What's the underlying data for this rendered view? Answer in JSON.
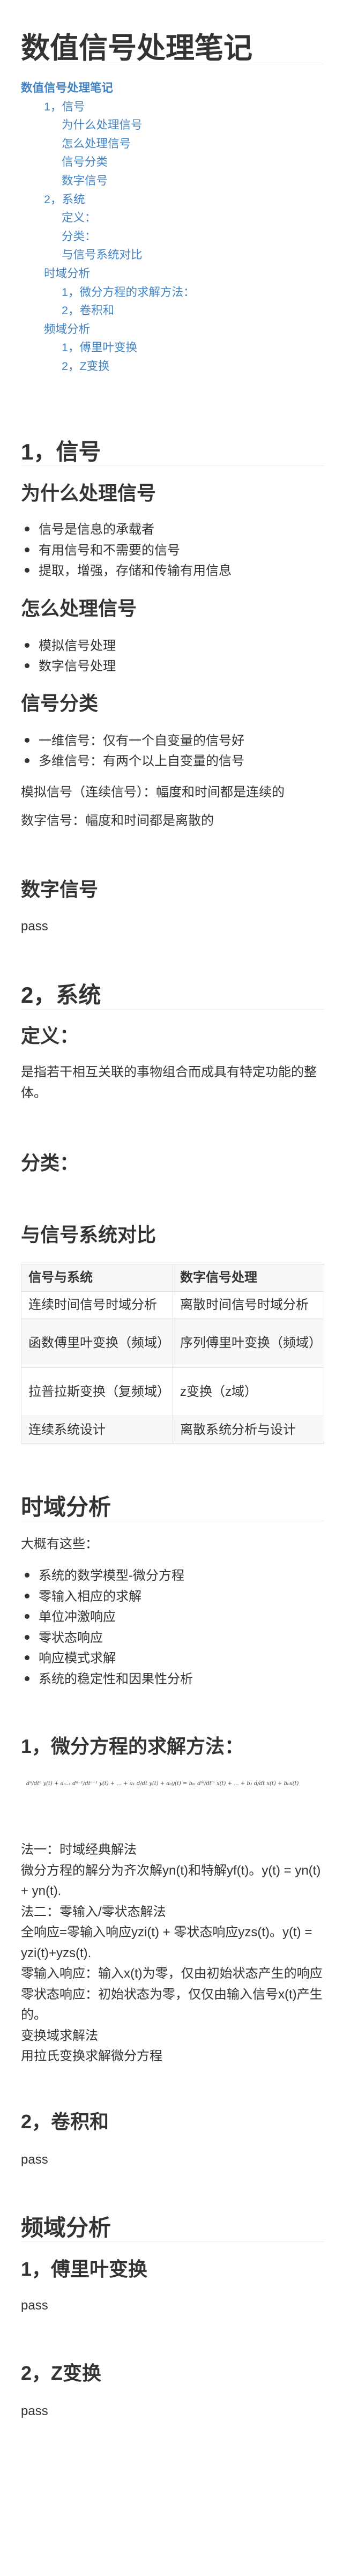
{
  "title": "数值信号处理笔记",
  "toc": [
    {
      "label": "数值信号处理笔记",
      "level": 0
    },
    {
      "label": "1，信号",
      "level": 1
    },
    {
      "label": "为什么处理信号",
      "level": 2
    },
    {
      "label": "怎么处理信号",
      "level": 2
    },
    {
      "label": "信号分类",
      "level": 2
    },
    {
      "label": "数字信号",
      "level": 2
    },
    {
      "label": "2，系统",
      "level": 1
    },
    {
      "label": "定义：",
      "level": 2
    },
    {
      "label": "分类：",
      "level": 2
    },
    {
      "label": "与信号系统对比",
      "level": 2
    },
    {
      "label": "时域分析",
      "level": 1
    },
    {
      "label": "1，微分方程的求解方法：",
      "level": 2
    },
    {
      "label": "2，卷积和",
      "level": 2
    },
    {
      "label": "频域分析",
      "level": 1
    },
    {
      "label": "1，傅里叶变换",
      "level": 2
    },
    {
      "label": "2，Z变换",
      "level": 2
    }
  ],
  "signal": {
    "heading": "1，信号",
    "why": {
      "heading": "为什么处理信号",
      "items": [
        "信号是信息的承载者",
        "有用信号和不需要的信号",
        "提取，增强，存储和传输有用信息"
      ]
    },
    "how": {
      "heading": "怎么处理信号",
      "items": [
        "模拟信号处理",
        "数字信号处理"
      ]
    },
    "classify": {
      "heading": "信号分类",
      "items": [
        "一维信号：仅有一个自变量的信号好",
        "多维信号：有两个以上自变量的信号"
      ],
      "analog": "模拟信号（连续信号）：幅度和时间都是连续的",
      "digital": "数字信号：幅度和时间都是离散的"
    },
    "digital_section": {
      "heading": "数字信号",
      "body": "pass"
    }
  },
  "system": {
    "heading": "2，系统",
    "definition": {
      "heading": "定义：",
      "body": "是指若干相互关联的事物组合而成具有特定功能的整体。"
    },
    "classify": {
      "heading": "分类："
    },
    "compare": {
      "heading": "与信号系统对比",
      "headers": [
        "信号与系统",
        "数字信号处理"
      ],
      "rows": [
        [
          "连续时间信号时域分析",
          "离散时间信号时域分析"
        ],
        [
          "函数傅里叶变换（频域）",
          "序列傅里叶变换（频域）"
        ],
        [
          "拉普拉斯变换（复频域）",
          "z变换（z域）"
        ],
        [
          "连续系统设计",
          "离散系统分析与设计"
        ]
      ]
    }
  },
  "time_domain": {
    "heading": "时域分析",
    "intro": "大概有这些：",
    "items": [
      "系统的数学模型-微分方程",
      "零输入相应的求解",
      "单位冲激响应",
      "零状态响应",
      "响应模式求解",
      "系统的稳定性和因果性分析"
    ],
    "ode": {
      "heading": "1，微分方程的求解方法：",
      "formula": "dⁿ/dtⁿ y(t) + aₙ₋₁ dⁿ⁻¹/dtⁿ⁻¹ y(t) + ... + a₁ d/dt y(t) + a₀y(t) = bₘ dᵐ/dtᵐ x(t) + ... + b₁ d/dt x(t) + b₀x(t)",
      "lines": [
        "法一：时域经典解法",
        "微分方程的解分为齐次解yn(t)和特解yf(t)。y(t) = yn(t) + yn(t).",
        "法二：零输入/零状态解法",
        "全响应=零输入响应yzi(t) + 零状态响应yzs(t)。y(t) = yzi(t)+yzs(t).",
        "零输入响应：输入x(t)为零，仅由初始状态产生的响应",
        "零状态响应：初始状态为零，仅仅由输入信号x(t)产生的。",
        "变换域求解法",
        "用拉氏变换求解微分方程"
      ]
    },
    "conv": {
      "heading": "2，卷积和",
      "body": "pass"
    }
  },
  "freq_domain": {
    "heading": "频域分析",
    "fourier": {
      "heading": "1，傅里叶变换",
      "body": "pass"
    },
    "z": {
      "heading": "2，Z变换",
      "body": "pass"
    }
  }
}
